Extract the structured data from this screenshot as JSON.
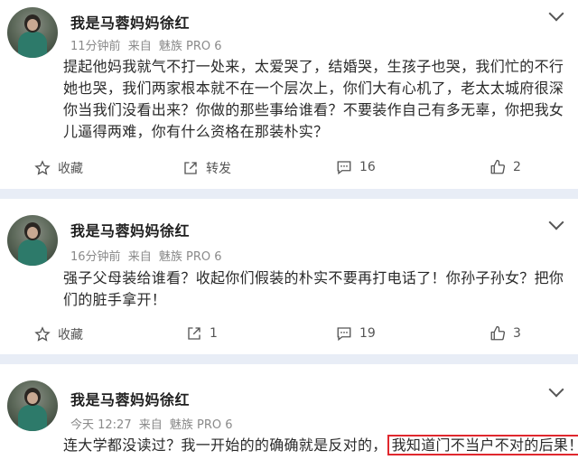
{
  "posts": [
    {
      "username": "我是马蓉妈妈徐红",
      "time": "11分钟前",
      "source_prefix": "来自",
      "device": "魅族 PRO 6",
      "content": "提起他妈我就气不打一处来，太爱哭了，结婚哭，生孩子也哭，我们忙的不行她也哭，我们两家根本就不在一个层次上，你们大有心机了，老太太城府很深你当我们没看出来？你做的那些事给谁看？不要装作自己有多无辜，你把我女儿逼得两难，你有什么资格在那装朴实？",
      "actions": {
        "collect": "收藏",
        "repost": "转发",
        "comments": "16",
        "likes": "2"
      }
    },
    {
      "username": "我是马蓉妈妈徐红",
      "time": "16分钟前",
      "source_prefix": "来自",
      "device": "魅族 PRO 6",
      "content": "强子父母装给谁看？收起你们假装的朴实不要再打电话了！你孙子孙女？把你们的脏手拿开！",
      "actions": {
        "collect": "收藏",
        "repost": "1",
        "comments": "19",
        "likes": "3"
      }
    },
    {
      "username": "我是马蓉妈妈徐红",
      "time": "今天 12:27",
      "source_prefix": "来自",
      "device": "魅族 PRO 6",
      "content_plain": "连大学都没读过？我一开始的的确确就是反对的，",
      "content_highlight": "我知道门不当户不对的后果！"
    }
  ],
  "colors": {
    "highlight_border": "#e0282e",
    "background": "#e8edf6"
  },
  "icons": [
    "chevron-down-icon",
    "star-icon",
    "repost-icon",
    "comment-icon",
    "like-icon"
  ]
}
